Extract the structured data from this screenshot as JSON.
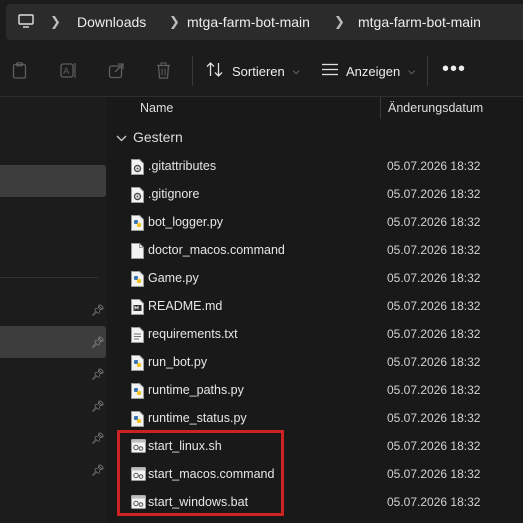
{
  "address": {
    "crumbs": [
      "Downloads",
      "mtga-farm-bot-main",
      "mtga-farm-bot-main"
    ]
  },
  "toolbar": {
    "sort_label": "Sortieren",
    "view_label": "Anzeigen"
  },
  "columns": {
    "name": "Name",
    "date": "Änderungsdatum"
  },
  "group": {
    "label": "Gestern"
  },
  "files": [
    {
      "name": ".gitattributes",
      "date": "05.07.2026 18:32",
      "icon": "settings-file-icon"
    },
    {
      "name": ".gitignore",
      "date": "05.07.2026 18:32",
      "icon": "settings-file-icon"
    },
    {
      "name": "bot_logger.py",
      "date": "05.07.2026 18:32",
      "icon": "python-file-icon"
    },
    {
      "name": "doctor_macos.command",
      "date": "05.07.2026 18:32",
      "icon": "blank-file-icon"
    },
    {
      "name": "Game.py",
      "date": "05.07.2026 18:32",
      "icon": "python-file-icon"
    },
    {
      "name": "README.md",
      "date": "05.07.2026 18:32",
      "icon": "markdown-file-icon"
    },
    {
      "name": "requirements.txt",
      "date": "05.07.2026 18:32",
      "icon": "text-file-icon"
    },
    {
      "name": "run_bot.py",
      "date": "05.07.2026 18:32",
      "icon": "python-file-icon"
    },
    {
      "name": "runtime_paths.py",
      "date": "05.07.2026 18:32",
      "icon": "python-file-icon"
    },
    {
      "name": "runtime_status.py",
      "date": "05.07.2026 18:32",
      "icon": "python-file-icon"
    },
    {
      "name": "start_linux.sh",
      "date": "05.07.2026 18:32",
      "icon": "script-file-icon"
    },
    {
      "name": "start_macos.command",
      "date": "05.07.2026 18:32",
      "icon": "script-file-icon"
    },
    {
      "name": "start_windows.bat",
      "date": "05.07.2026 18:32",
      "icon": "script-file-icon"
    }
  ],
  "colors": {
    "highlight": "#cc2222",
    "background": "#191919",
    "selection": "#3d3d3d"
  }
}
